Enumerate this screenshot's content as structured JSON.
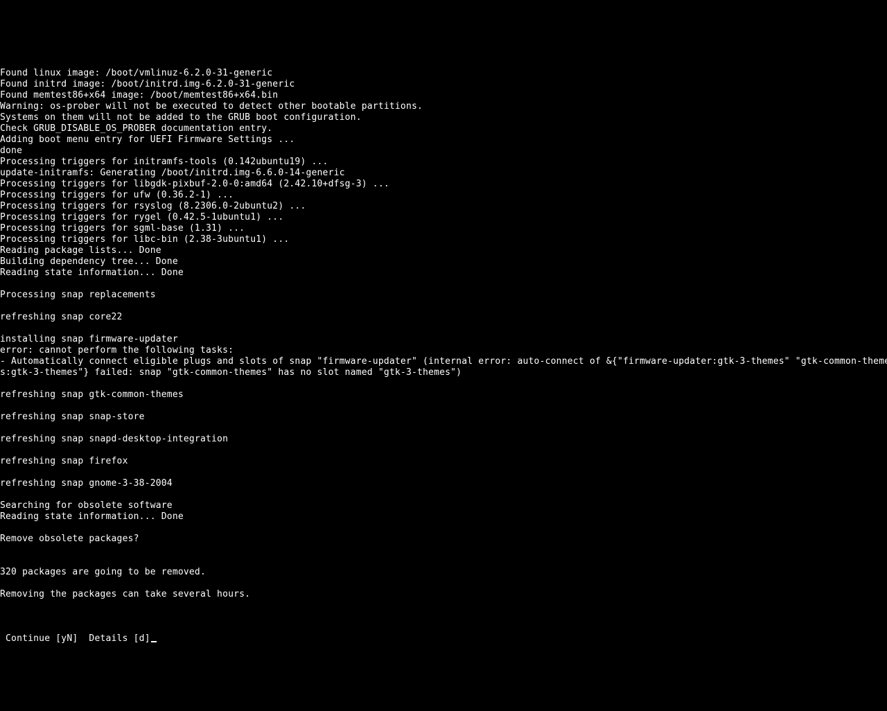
{
  "lines": [
    "Found linux image: /boot/vmlinuz-6.2.0-31-generic",
    "Found initrd image: /boot/initrd.img-6.2.0-31-generic",
    "Found memtest86+x64 image: /boot/memtest86+x64.bin",
    "Warning: os-prober will not be executed to detect other bootable partitions.",
    "Systems on them will not be added to the GRUB boot configuration.",
    "Check GRUB_DISABLE_OS_PROBER documentation entry.",
    "Adding boot menu entry for UEFI Firmware Settings ...",
    "done",
    "Processing triggers for initramfs-tools (0.142ubuntu19) ...",
    "update-initramfs: Generating /boot/initrd.img-6.6.0-14-generic",
    "Processing triggers for libgdk-pixbuf-2.0-0:amd64 (2.42.10+dfsg-3) ...",
    "Processing triggers for ufw (0.36.2-1) ...",
    "Processing triggers for rsyslog (8.2306.0-2ubuntu2) ...",
    "Processing triggers for rygel (0.42.5-1ubuntu1) ...",
    "Processing triggers for sgml-base (1.31) ...",
    "Processing triggers for libc-bin (2.38-3ubuntu1) ...",
    "Reading package lists... Done",
    "Building dependency tree... Done",
    "Reading state information... Done",
    "",
    "Processing snap replacements",
    "",
    "refreshing snap core22",
    "",
    "installing snap firmware-updater",
    "error: cannot perform the following tasks:",
    "- Automatically connect eligible plugs and slots of snap \"firmware-updater\" (internal error: auto-connect of &{\"firmware-updater:gtk-3-themes\" \"gtk-common-theme",
    "s:gtk-3-themes\"} failed: snap \"gtk-common-themes\" has no slot named \"gtk-3-themes\")",
    "",
    "refreshing snap gtk-common-themes",
    "",
    "refreshing snap snap-store",
    "",
    "refreshing snap snapd-desktop-integration",
    "",
    "refreshing snap firefox",
    "",
    "refreshing snap gnome-3-38-2004",
    "",
    "Searching for obsolete software",
    "Reading state information... Done",
    "",
    "Remove obsolete packages?",
    "",
    "",
    "320 packages are going to be removed.",
    "",
    "Removing the packages can take several hours.",
    ""
  ],
  "prompt": " Continue [yN]  Details [d]"
}
